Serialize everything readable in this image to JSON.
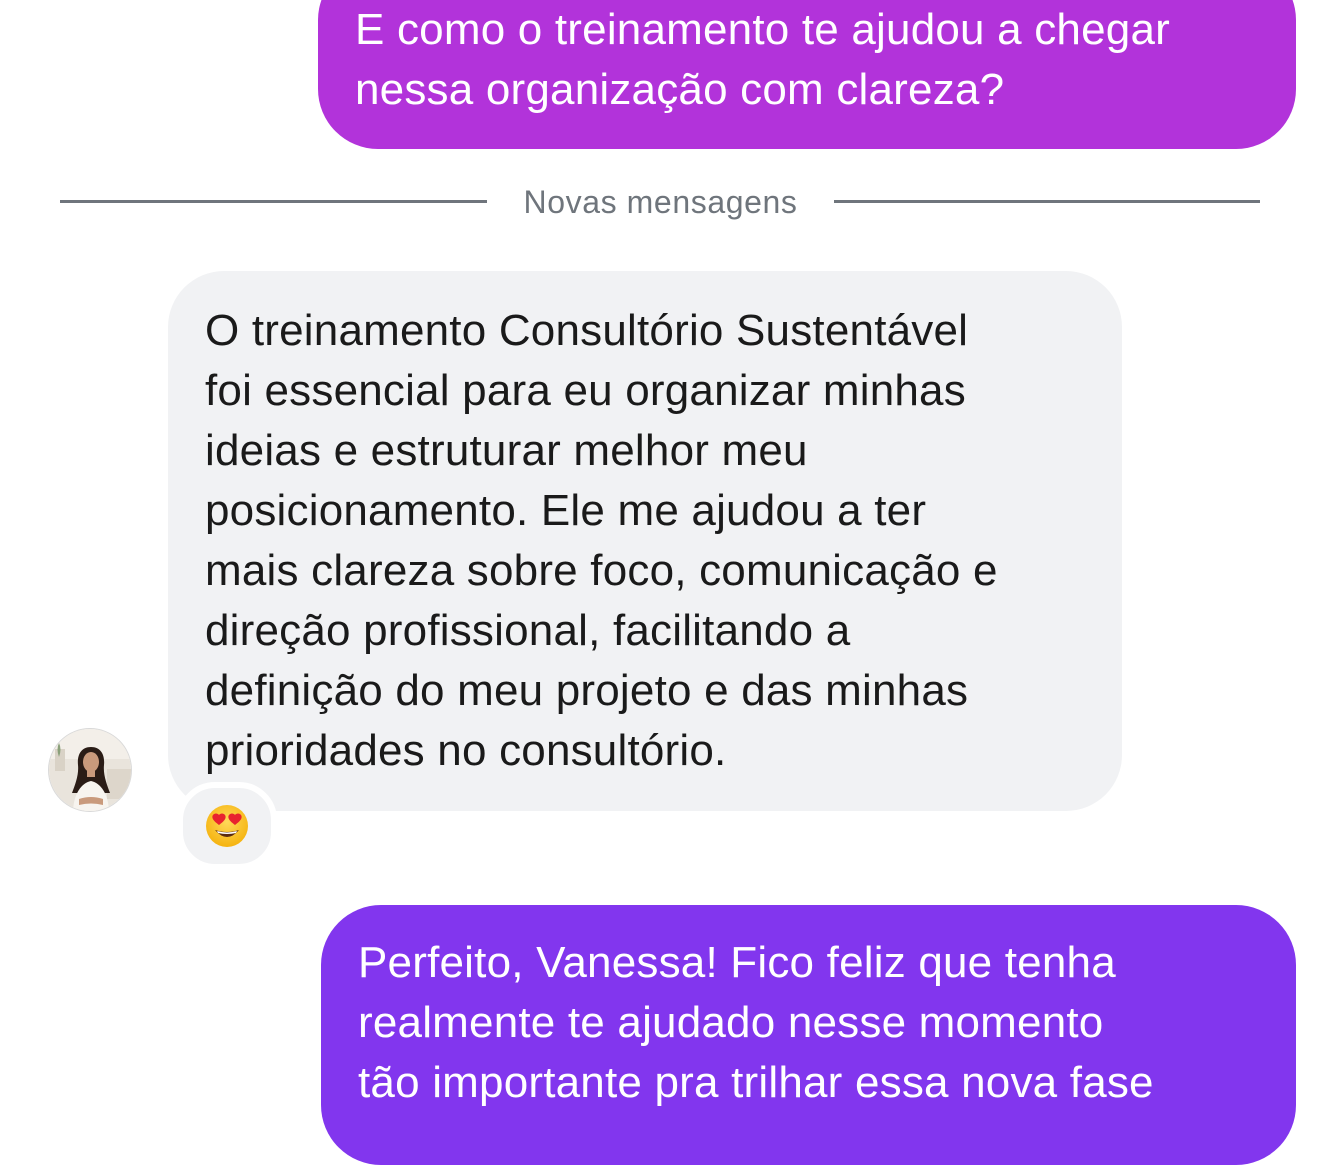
{
  "messages": {
    "outgoing_1": {
      "lines": [
        "E como o treinamento te ajudou a chegar",
        "nessa organização com clareza?"
      ],
      "color": "#b233da"
    },
    "divider": {
      "label": "Novas mensagens"
    },
    "incoming_1": {
      "lines": [
        "O treinamento Consultório Sustentável",
        "foi essencial para eu organizar minhas",
        "ideias e estruturar melhor meu",
        "posicionamento. Ele me ajudou a ter",
        "mais clareza sobre foco, comunicação e",
        "direção profissional, facilitando a",
        "definição do meu projeto e das minhas",
        "prioridades no consultório."
      ],
      "reaction": "heart-eyes-emoji",
      "avatar": "contact-avatar",
      "color": "#f1f2f4"
    },
    "outgoing_2": {
      "lines": [
        "Perfeito, Vanessa! Fico feliz que tenha",
        "realmente te ajudado nesse momento",
        "tão importante pra trilhar essa nova fase"
      ],
      "color": "#8236ee"
    }
  }
}
